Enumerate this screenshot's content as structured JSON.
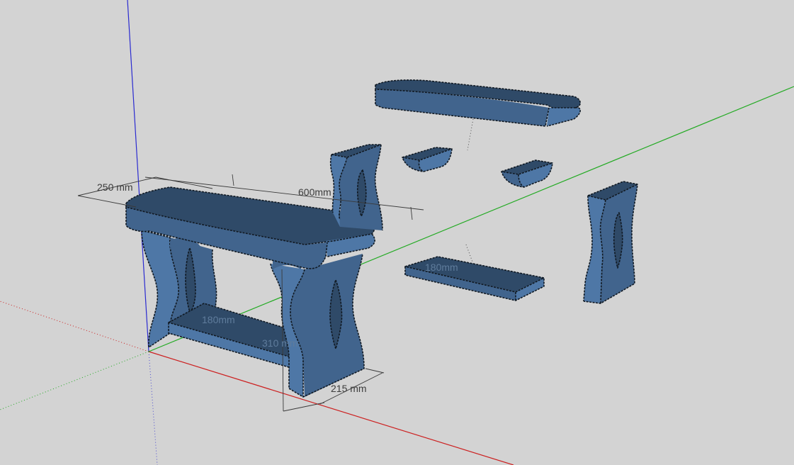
{
  "app": "SketchUp",
  "view": "3D perspective model viewport",
  "colors": {
    "background": "#d3d3d3",
    "model_face": "#4e77a6",
    "model_top": "#2f4a68",
    "edge": "#111a24",
    "axis_red": "#cc2222",
    "axis_green": "#22aa22",
    "axis_blue": "#2222cc"
  },
  "dimensions": {
    "depth_top": "250 mm",
    "length_top": "600mm",
    "shelf_width": "180mm",
    "height": "310 mm",
    "leg_depth": "215 mm",
    "exploded_shelf": "180mm"
  }
}
